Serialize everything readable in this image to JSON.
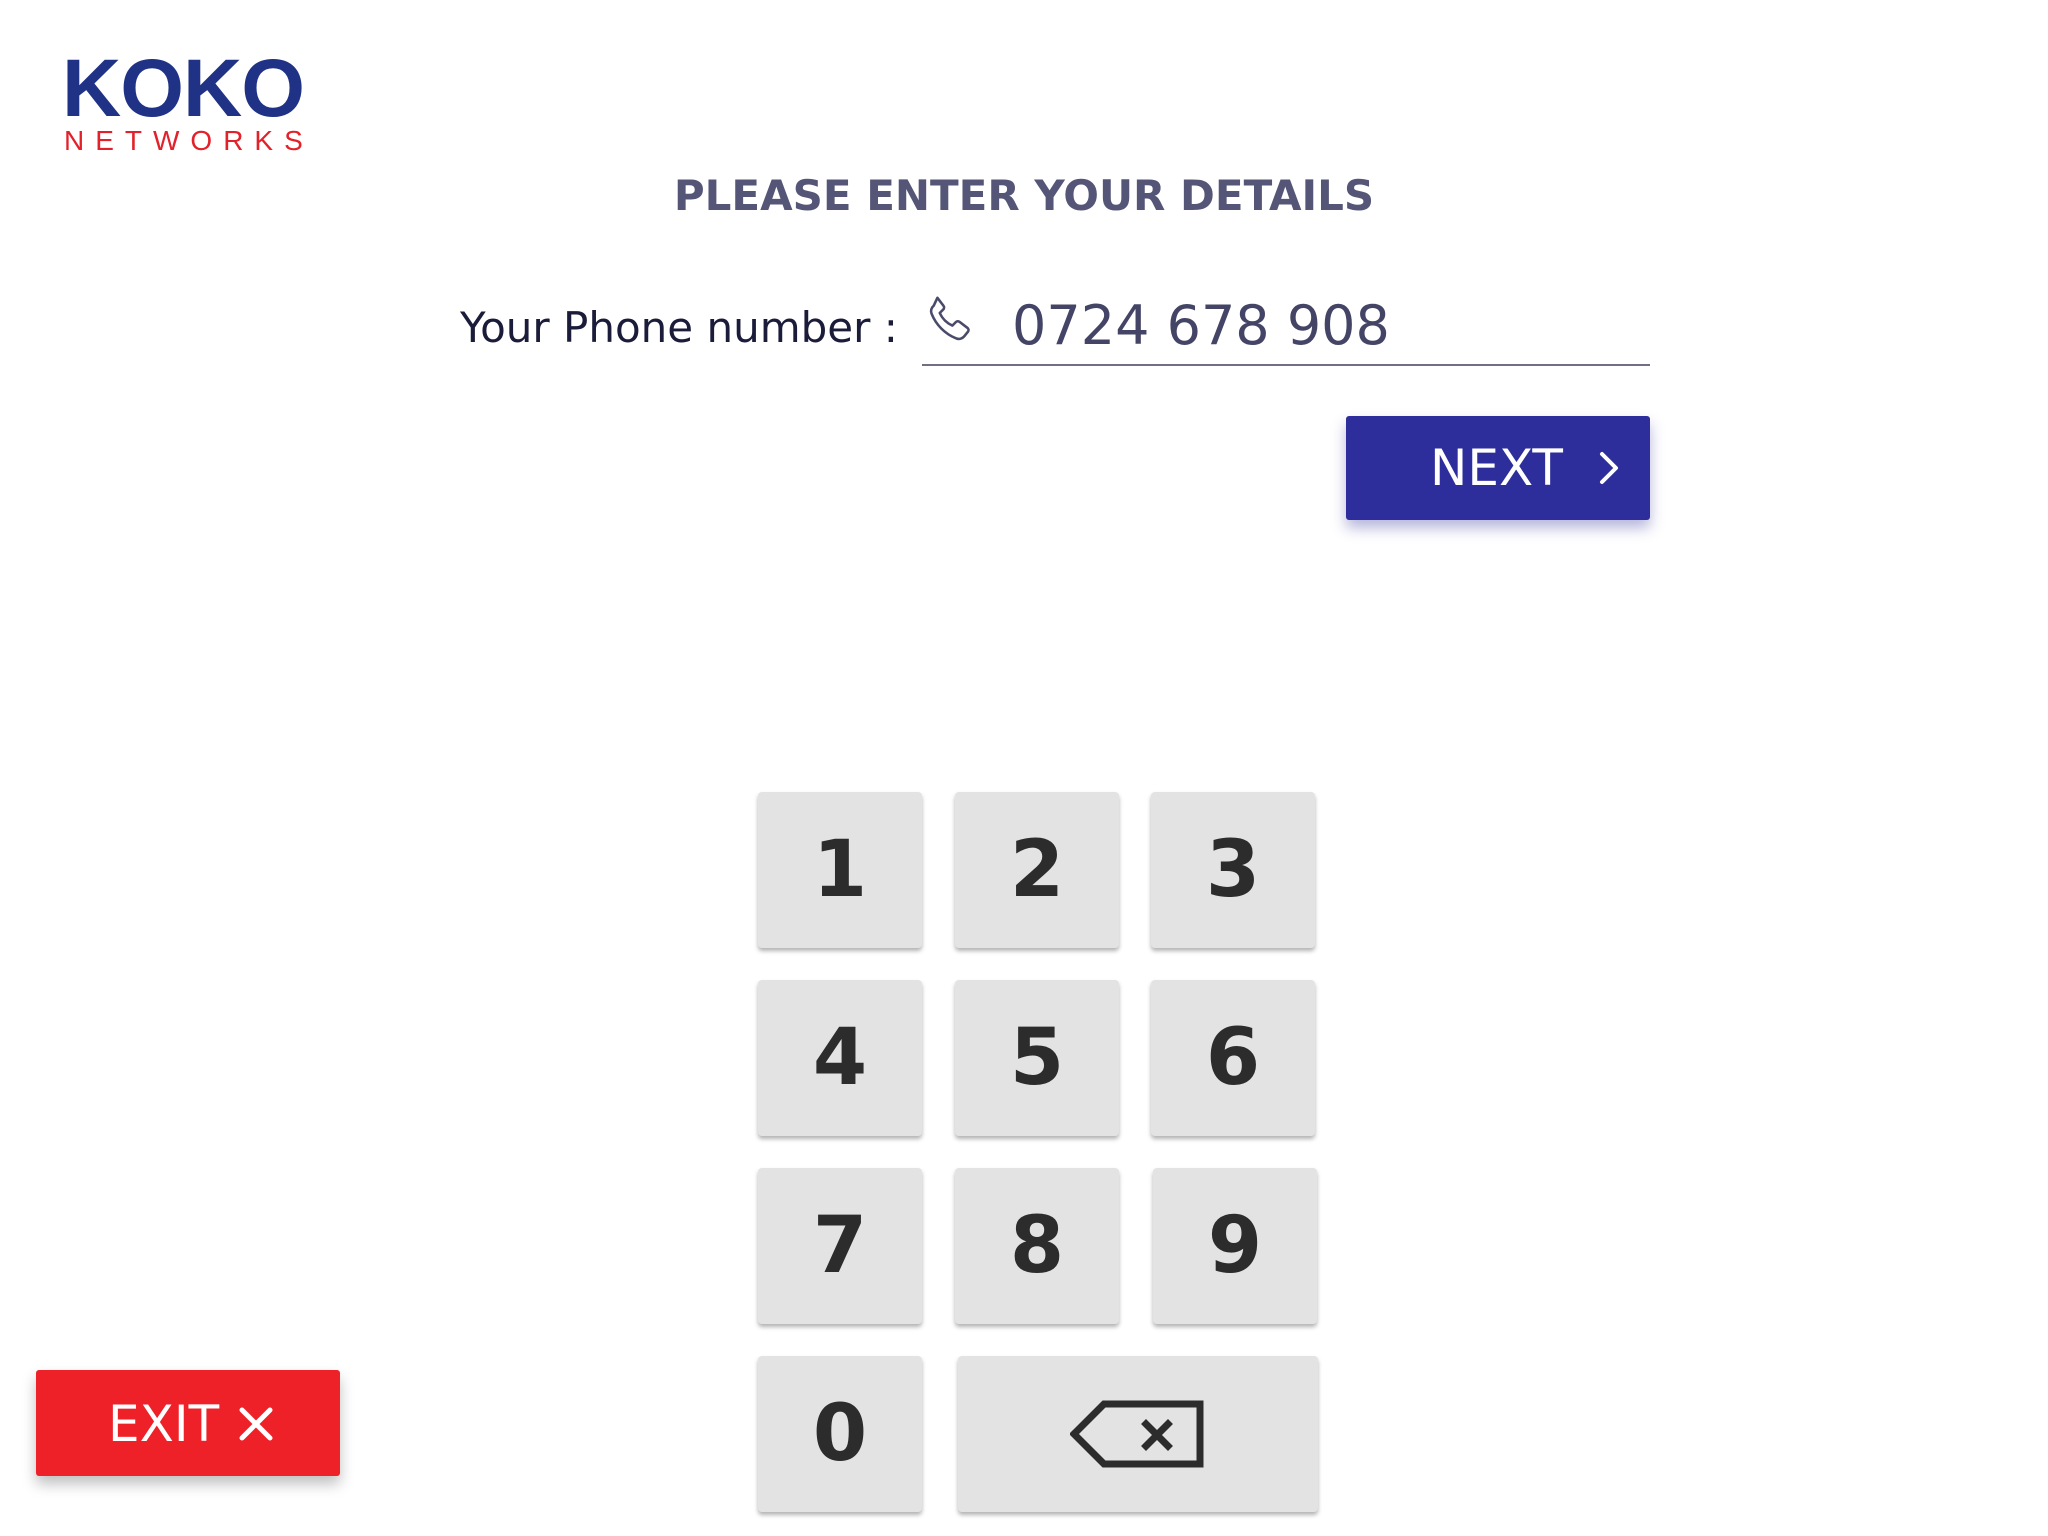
{
  "brand": {
    "name": "KOKO",
    "subtitle": "NETWORKS",
    "primary_color": "#1f3286",
    "accent_color": "#e2212b"
  },
  "form": {
    "title": "PLEASE ENTER YOUR DETAILS",
    "phone_label": "Your Phone number :",
    "phone_value": "0724 678 908",
    "phone_icon": "phone-icon"
  },
  "actions": {
    "next_label": "NEXT",
    "next_icon": "chevron-right-icon",
    "next_color": "#2d2e9c",
    "exit_label": "EXIT",
    "exit_icon": "close-icon",
    "exit_color": "#ee2028"
  },
  "keypad": {
    "keys": [
      "1",
      "2",
      "3",
      "4",
      "5",
      "6",
      "7",
      "8",
      "9",
      "0"
    ],
    "backspace_icon": "backspace-icon"
  }
}
